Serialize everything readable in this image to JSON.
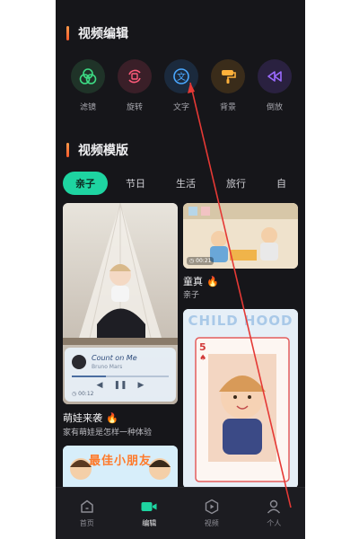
{
  "sections": {
    "edit_title": "视频编辑",
    "template_title": "视频模版"
  },
  "tools": [
    {
      "label": "滤镜",
      "icon": "filter-icon",
      "color": "#3ddc84",
      "bg": "#1f3328"
    },
    {
      "label": "旋转",
      "icon": "rotate-icon",
      "color": "#ff5b7a",
      "bg": "#3a1f28"
    },
    {
      "label": "文字",
      "icon": "text-icon",
      "color": "#4aa8ff",
      "bg": "#1b2a3d"
    },
    {
      "label": "背景",
      "icon": "paint-roller-icon",
      "color": "#ffb13b",
      "bg": "#3a2c1a"
    },
    {
      "label": "倒放",
      "icon": "rewind-icon",
      "color": "#9b6bff",
      "bg": "#2a2140"
    }
  ],
  "tabs": [
    "亲子",
    "节日",
    "生活",
    "旅行",
    "自"
  ],
  "cards": {
    "left_top": {
      "title": "萌娃来袭",
      "subtitle": "家有萌娃是怎样一种体验",
      "player": {
        "song": "Count on Me",
        "artist": "Bruno Mars",
        "time": "00:12"
      }
    },
    "right_top": {
      "title": "童真",
      "subtitle": "亲子",
      "time": "00:21"
    },
    "right_bottom": {
      "banner": "CHILD HOOD",
      "card_rank": "5"
    },
    "left_bottom": {
      "banner": "最佳小朋友"
    }
  },
  "bottom_nav": [
    {
      "label": "首页",
      "icon": "home-icon"
    },
    {
      "label": "编辑",
      "icon": "video-camera-icon"
    },
    {
      "label": "视频",
      "icon": "video-hexagon-icon"
    },
    {
      "label": "个人",
      "icon": "person-icon"
    }
  ]
}
